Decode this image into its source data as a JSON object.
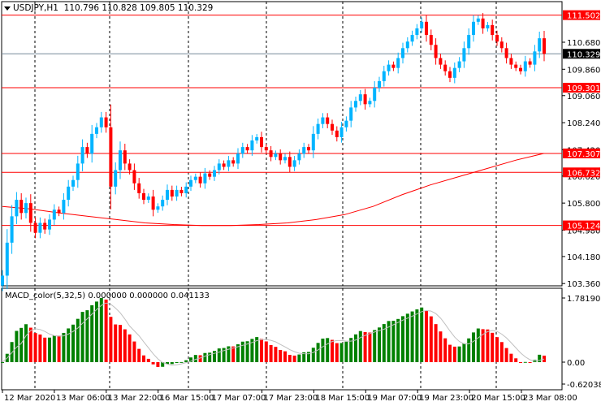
{
  "header": {
    "symbol_title": "USDJPY,H1",
    "ohlc": "110.796 110.828 109.805 110.329"
  },
  "indicator": {
    "label": "MACD_color(5,32,5) 0.000000 0.000000 0.041133",
    "axis_labels": [
      "1.781901",
      "0.00",
      "-0.620385"
    ]
  },
  "price_axis": {
    "ticks": [
      "110.680",
      "109.860",
      "109.060",
      "108.240",
      "107.420",
      "106.620",
      "105.800",
      "104.980",
      "104.180",
      "103.360"
    ],
    "current_price": "110.329"
  },
  "horizontal_lines": [
    "111.502",
    "109.301",
    "107.307",
    "106.732",
    "105.124"
  ],
  "time_axis": {
    "labels": [
      "12 Mar 2020",
      "13 Mar 06:00",
      "13 Mar 22:00",
      "16 Mar 15:00",
      "17 Mar 07:00",
      "17 Mar 23:00",
      "18 Mar 15:00",
      "19 Mar 07:00",
      "19 Mar 23:00",
      "20 Mar 15:00",
      "23 Mar 08:00"
    ]
  },
  "colors": {
    "bull": "#00B4FF",
    "bear": "#FF0000",
    "line": "#FF0000",
    "macd_up": "#008000",
    "macd_down": "#FF0000",
    "signal": "#C0C0C0",
    "current_price_bg": "#000000"
  },
  "chart_data": {
    "type": "candlestick",
    "timeframe": "H1",
    "closes": [
      103.6,
      104.6,
      105.4,
      105.9,
      105.5,
      105.8,
      105.2,
      104.9,
      105.2,
      105.0,
      105.3,
      105.6,
      105.5,
      105.9,
      106.3,
      106.5,
      107.0,
      107.5,
      107.3,
      107.9,
      108.1,
      108.4,
      108.1,
      106.3,
      106.8,
      107.4,
      107.0,
      106.8,
      106.4,
      106.1,
      105.9,
      106.0,
      105.6,
      105.7,
      105.9,
      106.2,
      106.0,
      106.2,
      106.1,
      106.3,
      106.5,
      106.6,
      106.4,
      106.7,
      106.6,
      106.8,
      107.0,
      106.9,
      107.1,
      107.0,
      107.3,
      107.5,
      107.4,
      107.7,
      107.8,
      107.5,
      107.4,
      107.2,
      107.3,
      107.1,
      107.2,
      106.9,
      107.1,
      107.3,
      107.5,
      107.4,
      107.9,
      108.2,
      108.4,
      108.2,
      108.0,
      107.8,
      108.1,
      108.3,
      108.7,
      108.9,
      109.1,
      108.8,
      108.9,
      109.3,
      109.5,
      109.8,
      110.0,
      109.9,
      110.2,
      110.5,
      110.7,
      110.9,
      111.1,
      111.3,
      110.9,
      110.6,
      110.2,
      110.0,
      109.8,
      109.6,
      109.9,
      110.1,
      110.5,
      110.9,
      111.3,
      111.4,
      111.1,
      111.2,
      110.9,
      110.7,
      110.5,
      110.2,
      110.0,
      109.9,
      109.8,
      110.1,
      110.0,
      110.4,
      110.8,
      110.329
    ],
    "moving_average": [
      105.7,
      105.62,
      105.5,
      105.4,
      105.3,
      105.2,
      105.15,
      105.12,
      105.12,
      105.15,
      105.2,
      105.3,
      105.45,
      105.7,
      106.05,
      106.35,
      106.6,
      106.85,
      107.1,
      107.307
    ],
    "ylim": [
      103.36,
      111.9
    ],
    "macd_params": [
      5,
      32,
      5
    ],
    "macd_ylim": [
      -0.620385,
      1.781901
    ]
  }
}
